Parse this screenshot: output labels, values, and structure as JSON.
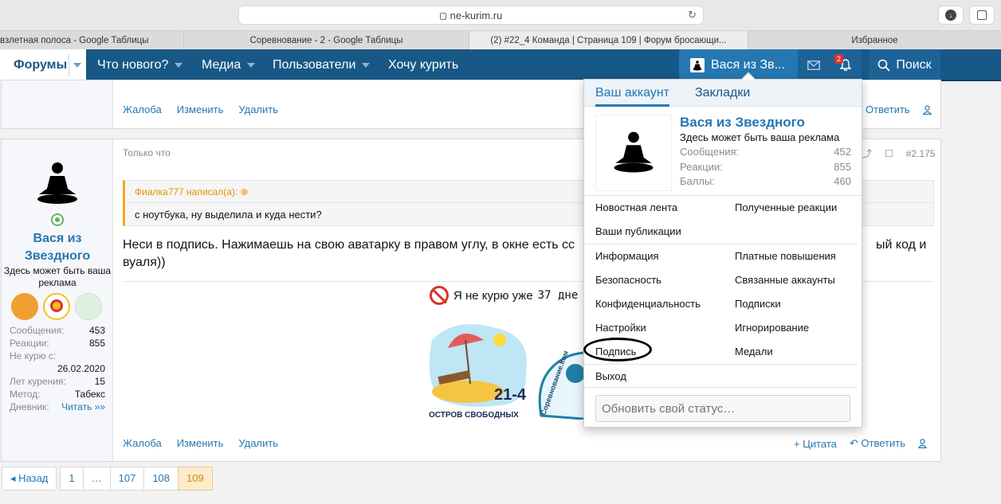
{
  "browser": {
    "url": "ne-kurim.ru",
    "tabs": [
      "взлетная полоса - Google Таблицы",
      "Соревнование - 2 - Google Таблицы",
      "(2) #22_4 Команда | Страница 109 | Форум бросающи...",
      "Избранное"
    ]
  },
  "nav": {
    "forums": "Форумы",
    "whats_new": "Что нового?",
    "media": "Медиа",
    "users": "Пользователи",
    "want_smoke": "Хочу курить",
    "user": "Вася из Зв...",
    "bell_badge": "2",
    "search": "Поиск"
  },
  "post1": {
    "actions": [
      "Жалоба",
      "Изменить",
      "Удалить"
    ],
    "reply": "Ответить"
  },
  "post2": {
    "time": "Только что",
    "number": "#2.175",
    "author": {
      "name": "Вася из Звездного",
      "title": "Здесь может быть ваша реклама",
      "stats": [
        {
          "k": "Сообщения:",
          "v": "453"
        },
        {
          "k": "Реакции:",
          "v": "855"
        },
        {
          "k": "Не курю с:",
          "v": ""
        }
      ],
      "since": "26.02.2020",
      "stats2": [
        {
          "k": "Лет курения:",
          "v": "15"
        },
        {
          "k": "Метод:",
          "v": "Табекс"
        },
        {
          "k": "Дневник:",
          "v": "Читать »»"
        }
      ]
    },
    "quote_head": "Фиалка777 написал(а):",
    "quote_body": "с ноутбука, ну выделила и куда нести?",
    "message_a": "Неси в подпись. Нажимаешь на свою аватарку в правом углу, в окне есть сс",
    "message_b": "ый код и",
    "message_c": "вуаля))",
    "sig_text": "Я не курю уже",
    "sig_days": "37 дне",
    "island_num": "21-4",
    "island_caption": "ОСТРОВ СВОБОДНЫХ",
    "island_arc": "Соревнование.Ком",
    "actions": [
      "Жалоба",
      "Изменить",
      "Удалить"
    ],
    "quote_btn": "+ Цитата",
    "reply": "Ответить"
  },
  "menu": {
    "tabs": [
      "Ваш аккаунт",
      "Закладки"
    ],
    "name": "Вася из Звездного",
    "title": "Здесь может быть ваша реклама",
    "stats": [
      {
        "k": "Сообщения:",
        "v": "452"
      },
      {
        "k": "Реакции:",
        "v": "855"
      },
      {
        "k": "Баллы:",
        "v": "460"
      }
    ],
    "links_left": [
      "Новостная лента",
      "Ваши публикации",
      "Информация",
      "Безопасность",
      "Конфиденциальность",
      "Настройки",
      "Подпись"
    ],
    "links_right": [
      "Полученные реакции",
      "Платные повышения",
      "Связанные аккаунты",
      "Подписки",
      "Игнорирование",
      "Медали"
    ],
    "logout": "Выход",
    "status_placeholder": "Обновить свой статус…"
  },
  "pager": {
    "back": "◂ Назад",
    "pages": [
      "1",
      "…",
      "107",
      "108",
      "109"
    ],
    "current": "109"
  },
  "colors": {
    "nav": "#185886",
    "accent": "#2577b1",
    "quote": "#f6a623"
  }
}
